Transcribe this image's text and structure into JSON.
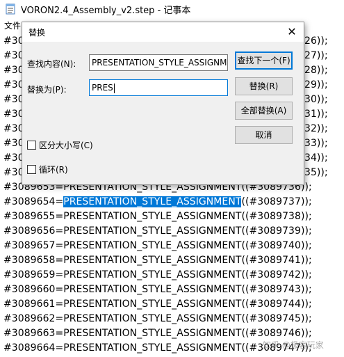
{
  "window": {
    "title": "VORON2.4_Assembly_v2.step - 记事本"
  },
  "menu": {
    "file": "文件"
  },
  "editor_lines": [
    "#30",
    "#30",
    "#30",
    "#30",
    "#30",
    "#30",
    "#30",
    "#30",
    "#30",
    "#30",
    "#3089653=PRESENTATION_STYLE_ASSIGNMENT((#3089736));",
    "#3089654=",
    "#3089655=PRESENTATION_STYLE_ASSIGNMENT((#3089738));",
    "#3089656=PRESENTATION_STYLE_ASSIGNMENT((#3089739));",
    "#3089657=PRESENTATION_STYLE_ASSIGNMENT((#3089740));",
    "#3089658=PRESENTATION_STYLE_ASSIGNMENT((#3089741));",
    "#3089659=PRESENTATION_STYLE_ASSIGNMENT((#3089742));",
    "#3089660=PRESENTATION_STYLE_ASSIGNMENT((#3089743));",
    "#3089661=PRESENTATION_STYLE_ASSIGNMENT((#3089744));",
    "#3089662=PRESENTATION_STYLE_ASSIGNMENT((#3089745));",
    "#3089663=PRESENTATION_STYLE_ASSIGNMENT((#3089746));",
    "#3089664=PRESENTATION_STYLE_ASSIGNMENT((#3089747));"
  ],
  "editor_line_tails": [
    "26));",
    "27));",
    "28));",
    "29));",
    "30));",
    "31));",
    "32));",
    "33));",
    "34));",
    "35));"
  ],
  "selected_line": {
    "prefix": "#3089654=",
    "selected": "PRESENTATION_STYLE_ASSIGNMENT",
    "suffix": "((#3089737));"
  },
  "dialog": {
    "title": "替换",
    "find_label": "查找内容(N):",
    "find_value": "PRESENTATION_STYLE_ASSIGNM",
    "replace_label": "替换为(P):",
    "replace_value": "PRES",
    "find_next_button": "查找下一个(F)",
    "replace_button": "替换(R)",
    "replace_all_button": "全部替换(A)",
    "cancel_button": "取消",
    "match_case_label": "区分大小写(C)",
    "wrap_label": "循环(R)"
  },
  "watermark": "知乎 @极客玩家"
}
